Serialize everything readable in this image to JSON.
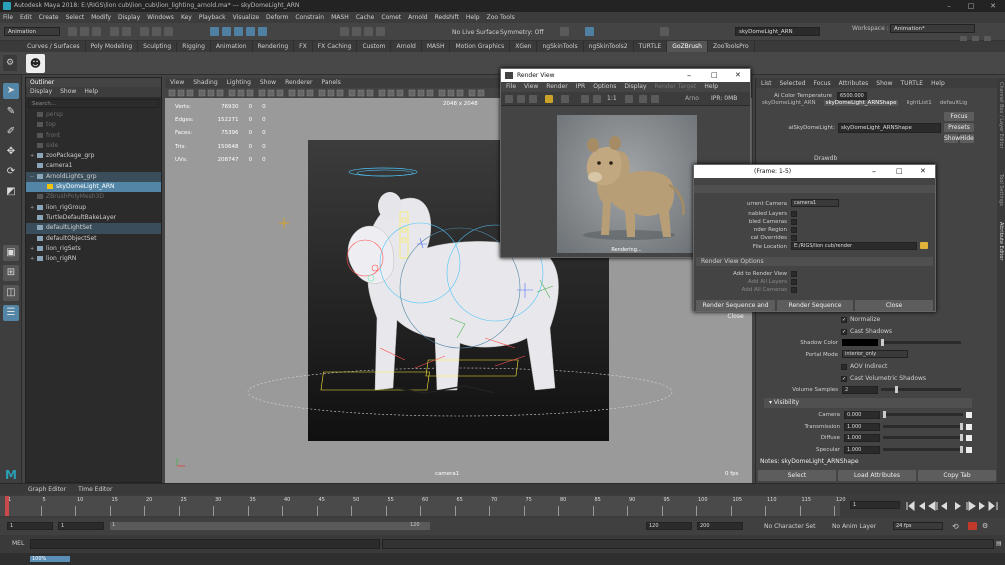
{
  "window": {
    "title": "Autodesk Maya 2018: E:\\RIGS\\lion cub\\lion_cub\\lion_lighting_arnold.ma*  ---  skyDomeLight_ARN",
    "controls": [
      "–",
      "□",
      "✕"
    ]
  },
  "menubar": [
    "File",
    "Edit",
    "Create",
    "Select",
    "Modify",
    "Display",
    "Windows",
    "Key",
    "Playback",
    "Visualize",
    "Deform",
    "Constrain",
    "MASH",
    "Cache",
    "Comet",
    "Arnold",
    "Redshift",
    "Help",
    "Zoo Tools"
  ],
  "statusline": {
    "mode": "Animation",
    "live_surface": "No Live Surface",
    "symmetry": "Symmetry: Off",
    "object_name": "skyDomeLight_ARN",
    "workspace_label": "Workspace :",
    "workspace": "Animation*"
  },
  "shelf_tabs": [
    "Curves / Surfaces",
    "Poly Modeling",
    "Sculpting",
    "Rigging",
    "Animation",
    "Rendering",
    "FX",
    "FX Caching",
    "Custom",
    "Arnold",
    "MASH",
    "Motion Graphics",
    "XGen",
    "ngSkinTools",
    "ngSkinTools2",
    "TURTLE",
    "GoZBrush",
    "ZooToolsPro"
  ],
  "active_shelf_tab": "GoZBrush",
  "outliner": {
    "title": "Outliner",
    "menu": [
      "Display",
      "Show",
      "Help"
    ],
    "search_placeholder": "Search...",
    "items": [
      {
        "label": "persp",
        "state": "dim",
        "expand": ""
      },
      {
        "label": "top",
        "state": "dim",
        "expand": ""
      },
      {
        "label": "front",
        "state": "dim",
        "expand": ""
      },
      {
        "label": "side",
        "state": "dim",
        "expand": ""
      },
      {
        "label": "zooPackage_grp",
        "state": "",
        "expand": "+"
      },
      {
        "label": "camera1",
        "state": "",
        "expand": ""
      },
      {
        "label": "ArnoldLights_grp",
        "state": "hl",
        "expand": "−"
      },
      {
        "label": "skyDomeLight_ARN",
        "state": "sel",
        "expand": ""
      },
      {
        "label": "ZBrushPolyMesh3D",
        "state": "dim",
        "expand": ""
      },
      {
        "label": "lion_rigGroup",
        "state": "",
        "expand": "+"
      },
      {
        "label": "TurtleDefaultBakeLayer",
        "state": "",
        "expand": ""
      },
      {
        "label": "defaultLightSet",
        "state": "hl",
        "expand": ""
      },
      {
        "label": "defaultObjectSet",
        "state": "",
        "expand": ""
      },
      {
        "label": "lion_rigSets",
        "state": "",
        "expand": "+"
      },
      {
        "label": "lion_rigRN",
        "state": "",
        "expand": "+"
      }
    ]
  },
  "viewport": {
    "menu": [
      "View",
      "Shading",
      "Lighting",
      "Show",
      "Renderer",
      "Panels"
    ],
    "resolution": "2048 x 2048",
    "stats": [
      {
        "label": "Verts:",
        "v1": "76930",
        "v2": "0",
        "v3": "0"
      },
      {
        "label": "Edges:",
        "v1": "152271",
        "v2": "0",
        "v3": "0"
      },
      {
        "label": "Faces:",
        "v1": "75396",
        "v2": "0",
        "v3": "0"
      },
      {
        "label": "Tris:",
        "v1": "150648",
        "v2": "0",
        "v3": "0"
      },
      {
        "label": "UVs:",
        "v1": "208747",
        "v2": "0",
        "v3": "0"
      }
    ],
    "camera": "camera1",
    "fps": "0 fps"
  },
  "render_view": {
    "title": "Render View",
    "menu": [
      "File",
      "View",
      "Render",
      "IPR",
      "Options",
      "Display",
      "Render Target",
      "Help"
    ],
    "renderer_short": "Arno",
    "ipr": "IPR: 0MB",
    "ratio": "1:1",
    "status": "Rendering..."
  },
  "render_settings": {
    "title": "(Frame: 1-5)",
    "current_camera_label": "urrent Camera",
    "current_camera": "camera1",
    "checks": [
      "nabled Layers",
      "bled Cameras",
      "nder Region",
      "cal Overrides"
    ],
    "file_location_label": "File Location",
    "file_location": "E:/RIGS/lion cub/render",
    "section": "Render View Options",
    "add_to": "Add to Render View",
    "add_layers": "Add All Layers",
    "add_cameras": "Add All Cameras",
    "buttons": [
      "Render Sequence and Close",
      "Render Sequence",
      "Close"
    ]
  },
  "channelbox": {
    "menu": [
      "List",
      "Selected",
      "Focus",
      "Attributes",
      "Show",
      "TURTLE",
      "Help"
    ],
    "tabs": [
      "skyDomeLight_ARN",
      "skyDomeLight_ARNShape",
      "lightList1",
      "defaultLig"
    ],
    "active_tab": "skyDomeLight_ARNShape",
    "color_temp_label": "Ai Color Temperature",
    "color_temp": "6500.000",
    "node_label": "aiSkyDomeLight:",
    "node_value": "skyDomeLight_ARNShape",
    "node_buttons": [
      "Focus",
      "Presets",
      "Show",
      "Hide"
    ],
    "drawdb": "Drawdb",
    "normalize": "Normalize",
    "cast_shadows": "Cast Shadows",
    "shadow_color_label": "Shadow Color",
    "portal_mode_label": "Portal Mode",
    "portal_mode": "interior_only",
    "aov_indirect": "AOV Indirect",
    "cast_volumetric": "Cast Volumetric Shadows",
    "volume_samples_label": "Volume Samples",
    "volume_samples": "2",
    "visibility_section": "Visibility",
    "visibility": [
      {
        "label": "Camera",
        "value": "0.000"
      },
      {
        "label": "Transmission",
        "value": "1.000"
      },
      {
        "label": "Diffuse",
        "value": "1.000"
      },
      {
        "label": "Specular",
        "value": "1.000"
      }
    ],
    "notes": "Notes:  skyDomeLight_ARNShape",
    "bottom_buttons": [
      "Select",
      "Load Attributes",
      "Copy Tab"
    ]
  },
  "side_strip": [
    "Channel Box / Layer Editor",
    "Tool Settings",
    "Attribute Editor"
  ],
  "bottom_tabs": [
    "Graph Editor",
    "Time Editor"
  ],
  "timeline": {
    "ticks": [
      "1",
      "5",
      "10",
      "15",
      "20",
      "25",
      "30",
      "35",
      "40",
      "45",
      "50",
      "55",
      "60",
      "65",
      "70",
      "75",
      "80",
      "85",
      "90",
      "95",
      "100",
      "105",
      "110",
      "115",
      "120"
    ],
    "current_frame": "1"
  },
  "range": {
    "start": "1",
    "anim_start": "1",
    "range_start": "1",
    "range_end": "120",
    "anim_end": "120",
    "end": "200",
    "character_set": "No Character Set",
    "anim_layer": "No Anim Layer",
    "fps": "24 fps"
  },
  "cmdline": {
    "lang": "MEL"
  },
  "helpline": {
    "progress": "100%"
  },
  "colors": {
    "selection": "#5285a6",
    "accent": "#2a9fb5",
    "record": "#c0392b"
  }
}
